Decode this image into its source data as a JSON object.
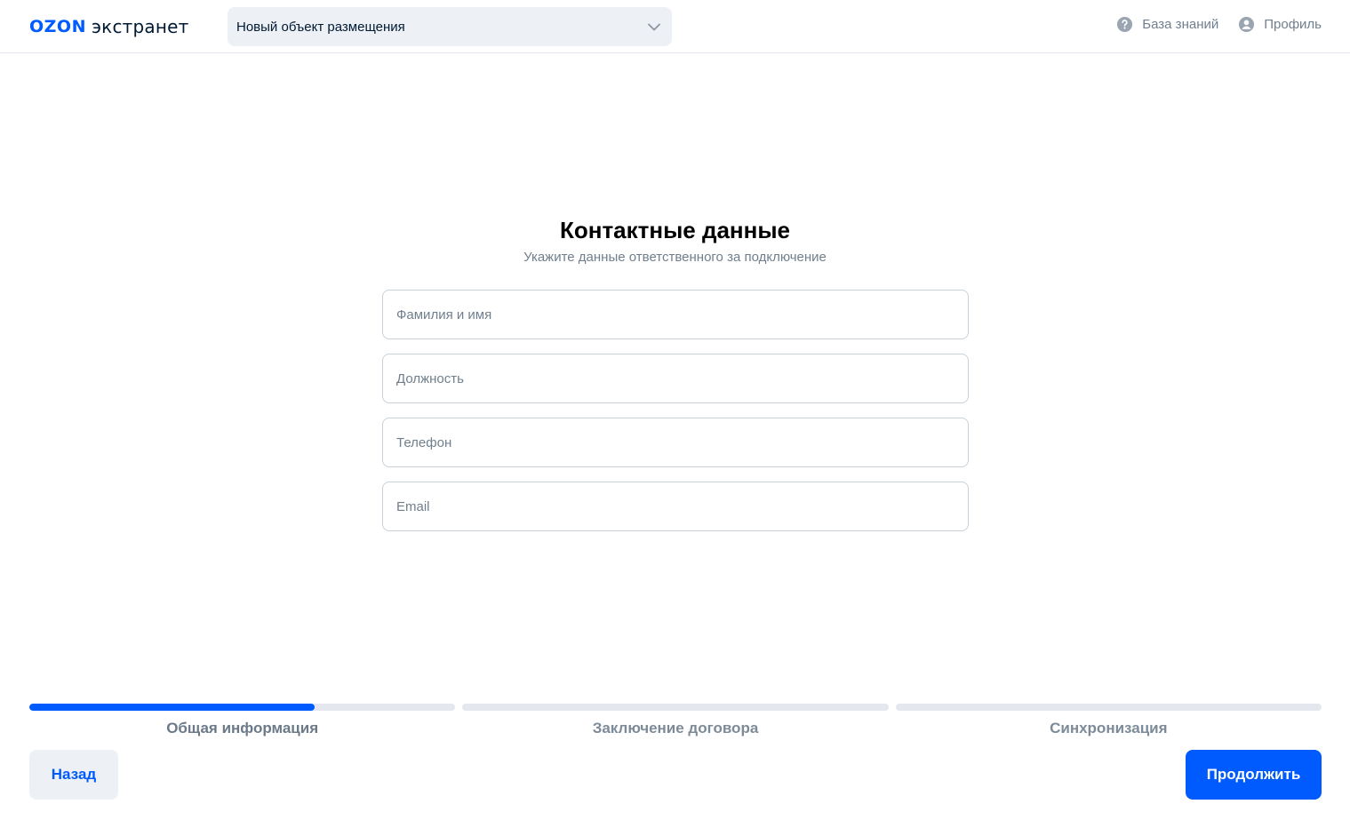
{
  "header": {
    "logo_brand": "OZON",
    "logo_product": "экстранет",
    "property_select": {
      "value": "Новый объект размещения",
      "icon": "chevron-down-icon"
    },
    "nav": [
      {
        "label": "База знаний",
        "icon": "help-circle-icon"
      },
      {
        "label": "Профиль",
        "icon": "user-circle-icon"
      }
    ]
  },
  "main": {
    "title": "Контактные данные",
    "subtitle": "Укажите данные ответственного за подключение",
    "fields": [
      {
        "placeholder": "Фамилия и имя",
        "value": ""
      },
      {
        "placeholder": "Должность",
        "value": ""
      },
      {
        "placeholder": "Телефон",
        "value": ""
      },
      {
        "placeholder": "Email",
        "value": ""
      }
    ]
  },
  "progress": {
    "steps": [
      {
        "label": "Общая информация",
        "progress": 0.67
      },
      {
        "label": "Заключение договора",
        "progress": 0
      },
      {
        "label": "Синхронизация",
        "progress": 0
      }
    ]
  },
  "footer": {
    "back_label": "Назад",
    "next_label": "Продолжить"
  },
  "colors": {
    "accent": "#005bff",
    "muted_text": "#707f8d",
    "track": "#e4e8ee",
    "secondary_button_bg": "#edf0f4"
  }
}
